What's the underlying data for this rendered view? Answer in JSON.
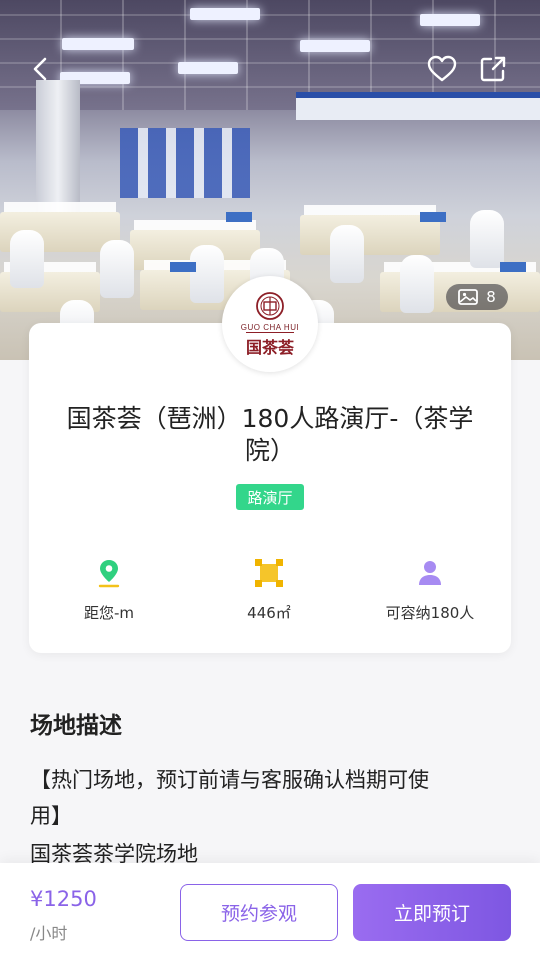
{
  "header": {
    "back_icon": "chevron-left-icon",
    "favorite_icon": "heart-outline-icon",
    "share_icon": "share-external-icon",
    "photo_count": "8"
  },
  "venue": {
    "logo_roman": "GUO CHA HUI",
    "logo_cn": "国茶荟",
    "title": "国茶荟（琶洲）180人路演厅-（茶学院）",
    "tag": "路演厅",
    "tag_color": "#33d68b",
    "stats": [
      {
        "icon": "location-pin-icon",
        "label": "距您-m"
      },
      {
        "icon": "area-icon",
        "label": "446㎡"
      },
      {
        "icon": "person-icon",
        "label": "可容纳180人"
      }
    ]
  },
  "description": {
    "heading": "场地描述",
    "line1": "【热门场地，预订前请与客服确认档期可使",
    "line2": "用】",
    "line3": "国茶荟茶学院场地"
  },
  "footer": {
    "price": "¥1250",
    "unit": "/小时",
    "visit_label": "预约参观",
    "book_label": "立即预订",
    "accent": "#8a63e8"
  }
}
